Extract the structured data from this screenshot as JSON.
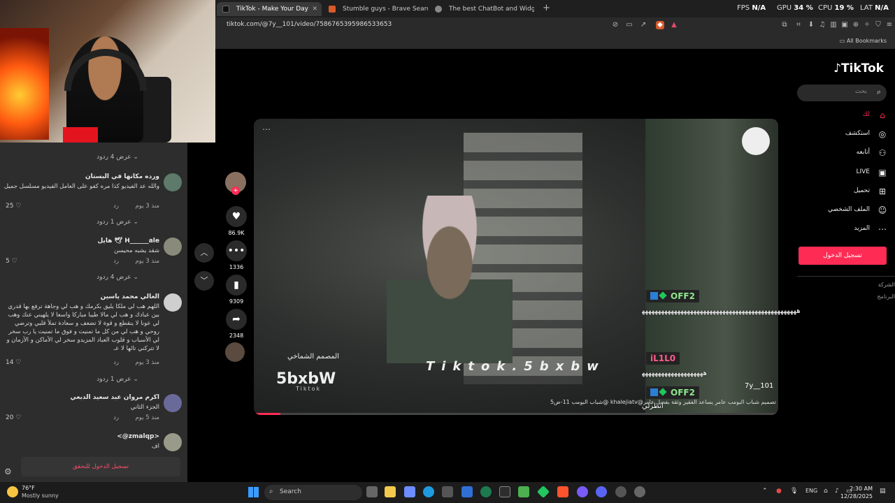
{
  "browser": {
    "tabs": [
      {
        "title": "TikTok - Make Your Day"
      },
      {
        "title": "Stumble guys - Brave Search"
      },
      {
        "title": "The best ChatBot and Widgets for K"
      }
    ],
    "new_tab": "+",
    "stats": {
      "fps_label": "FPS",
      "fps_value": "N/A",
      "gpu_label": "GPU",
      "gpu_value": "34 %",
      "cpu_label": "CPU",
      "cpu_value": "19 %",
      "lat_label": "LAT",
      "lat_value": "N/A"
    },
    "url": "tiktok.com/@7y__101/video/7586765395986533653",
    "all_bookmarks": "All Bookmarks"
  },
  "comments_panel": {
    "show_replies_top": "عرض 4 ردود",
    "comments": [
      {
        "name": "ورده مكانها في البستان",
        "text": "والله عد الفيديو كذا مره كفو على العامل الفيديو مسلسل جميل",
        "meta_time": "منذ 3 يوم",
        "meta_reply": "رد",
        "likes": "25"
      },
      {
        "name": "H______ale 🕊 هايل",
        "text": "شقد يشبه محيسن",
        "meta_time": "منذ 3 يوم",
        "meta_reply": "رد",
        "likes": "5"
      },
      {
        "name": "الغالي محمد ياسين",
        "text": "اللهم هب لي ملكا يليق بكرمك و هب لي وجاهة ترفع بها قدري بين عبادك و هب لي مالا طيبا مباركا واسعا لا يلهيني عنك وهب لي عونا لا ينقطع و قوة لا تضعف و سعادة تملأ قلبي وترضي روحي و هب لي من كل ما تمنيت و فوق ما تمنيت يا رب سخر لي الأسباب و قلوب العباد المزيدو سخر لي الأماكن و الأزمان و لا تتركني تائها لا عـ",
        "meta_time": "منذ 3 يوم",
        "meta_reply": "رد",
        "likes": "14"
      },
      {
        "name": "اكرم مروان عبد سعيد الدبعي",
        "text": "الجزء الثاني",
        "meta_time": "منذ 5 يوم",
        "meta_reply": "رد",
        "likes": "20"
      },
      {
        "name": "<zmalqp@>",
        "text": "اف",
        "meta_time": "",
        "meta_reply": "",
        "likes": ""
      }
    ],
    "show_replies": [
      "عرض 1 ردود",
      "عرض 4 ردود",
      "عرض 1 ردود"
    ],
    "login_to_verify": "تسجيل الدخول للتحقق"
  },
  "video": {
    "counts": {
      "likes": "86.9K",
      "comments": "1336",
      "saves": "9309",
      "shares": "2348"
    },
    "progress_fraction": 0.05,
    "watermark": "Tiktok.5bxbw",
    "logo_text": "5bxbW",
    "logo_sub": "المصمم الشماخي",
    "logo_small": "Tiktok",
    "author": "7y__101",
    "caption": "تصميم شباب البومب عامر يساعد الفقير وثقة بفضل عامر@khalejiatv @شباب البومب 11-ض5"
  },
  "sidebar": {
    "logo": "TikTok",
    "search_placeholder": "بحث",
    "nav": [
      {
        "label": "لك",
        "active": true
      },
      {
        "label": "استكشف",
        "active": false
      },
      {
        "label": "أتابعه",
        "active": false
      },
      {
        "label": "LIVE",
        "active": false
      },
      {
        "label": "تحميل",
        "active": false
      },
      {
        "label": "الملف الشخصي",
        "active": false
      },
      {
        "label": "المزيد",
        "active": false
      }
    ],
    "login_button": "تسجيل الدخول",
    "footer": [
      "الشركة",
      "البرنامج"
    ]
  },
  "chat": [
    {
      "name": "OFF2",
      "name_color": "#8ee88e",
      "message": "ﻫﻬﻬﻬﻬﻬﻬﻬﻬﻬﻬﻬﻬﻬﻬﻬﻬﻬﻬﻬﻬﻬﻬﻬﻬﻬﻬﻬﻬﻬﻬﻬﻬﻬﻬﻬﻬﻬﻬﻬﻬﻬﻬﻬﻬﻬﻬﻬﻬ"
    },
    {
      "name": "iL1L0",
      "name_color": "#ff5b8a",
      "message": "ﻫﻬﻬﻬﻬﻬﻬﻬﻬﻬﻬﻬﻬﻬﻬﻬﻬﻬﻬﻬ"
    },
    {
      "name": "OFF2",
      "name_color": "#8ee88e",
      "message": "انطرلي"
    }
  ],
  "taskbar": {
    "weather_temp": "76°F",
    "weather_desc": "Mostly sunny",
    "search_label": "Search",
    "lang": "ENG",
    "time": "2:30 AM",
    "date": "12/28/2025"
  }
}
